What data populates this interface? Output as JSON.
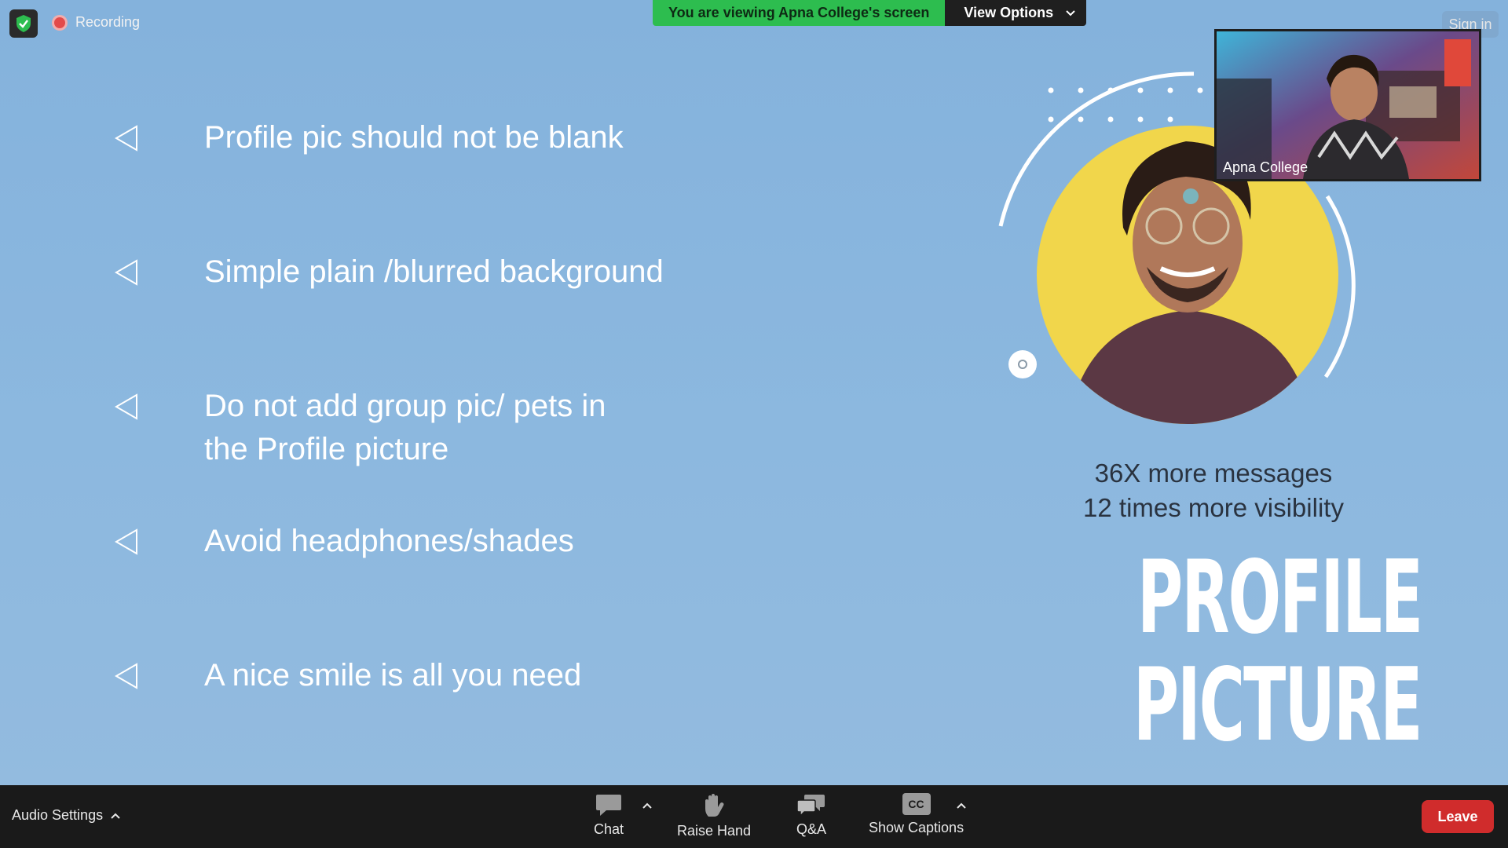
{
  "top_bar": {
    "recording_label": "Recording",
    "viewing_text": "You are viewing Apna College's screen",
    "view_options_label": "View Options",
    "sign_in_label": "Sign in"
  },
  "slide": {
    "bullets": [
      {
        "line1": "Profile pic should not be blank",
        "line2": ""
      },
      {
        "line1": "Simple plain /blurred background",
        "line2": ""
      },
      {
        "line1": "Do not add group pic/ pets in",
        "line2": "the Profile picture"
      },
      {
        "line1": "Avoid headphones/shades",
        "line2": ""
      },
      {
        "line1": "A nice smile is all you need",
        "line2": ""
      }
    ],
    "stat1": "36X more messages",
    "stat2": "12 times more visibility",
    "title_line1": "PROFILE",
    "title_line2": "PICTURE"
  },
  "video": {
    "participant_name": "Apna College"
  },
  "toolbar": {
    "audio_settings_label": "Audio Settings",
    "chat_label": "Chat",
    "raise_hand_label": "Raise Hand",
    "qa_label": "Q&A",
    "captions_label": "Show Captions",
    "cc_text": "CC",
    "leave_label": "Leave"
  },
  "colors": {
    "slide_bg": "#89b4dc",
    "banner_green": "#2dbd4f",
    "leave_red": "#d02c2c",
    "portrait_yellow": "#f1d64b"
  }
}
